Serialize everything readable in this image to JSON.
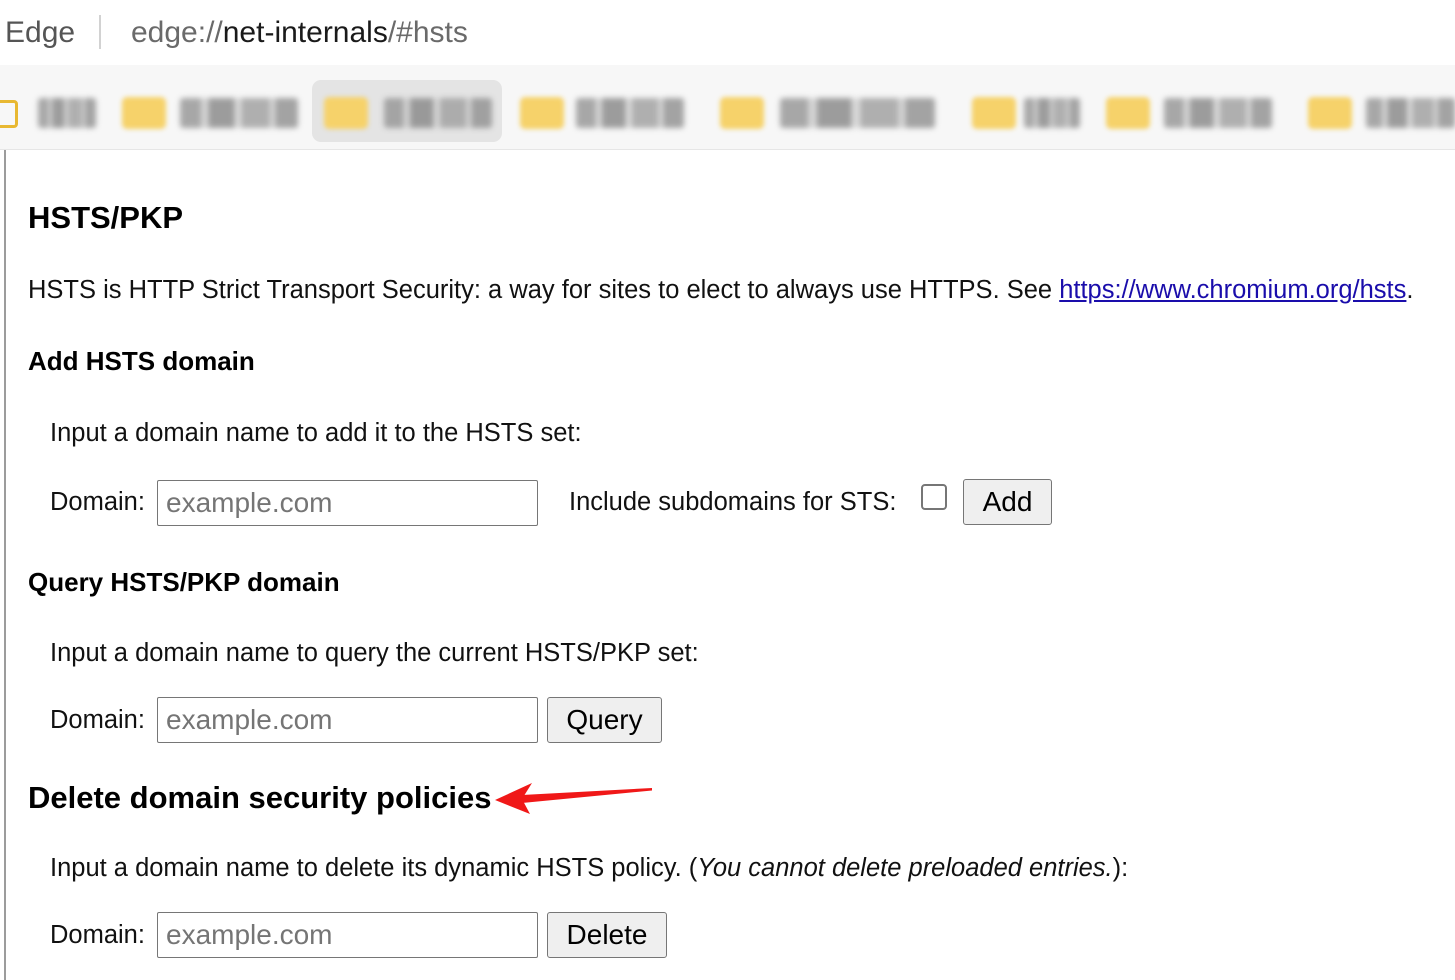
{
  "browser": {
    "app_name": "Edge",
    "url_scheme": "edge://",
    "url_host": "net-internals",
    "url_path": "/#hsts"
  },
  "bookmarks": [
    {
      "icon": "folder-icon",
      "highlighted": false
    },
    {
      "icon": "folder-icon",
      "highlighted": false
    },
    {
      "icon": "folder-icon",
      "highlighted": true
    },
    {
      "icon": "folder-icon",
      "highlighted": false
    },
    {
      "icon": "folder-icon",
      "highlighted": false
    },
    {
      "icon": "folder-icon",
      "highlighted": false
    },
    {
      "icon": "folder-icon",
      "highlighted": false
    },
    {
      "icon": "folder-icon",
      "highlighted": false
    }
  ],
  "page": {
    "title": "HSTS/PKP",
    "intro": {
      "text": "HSTS is HTTP Strict Transport Security: a way for sites to elect to always use HTTPS. See ",
      "link": "https://www.chromium.org/hsts",
      "suffix": "."
    },
    "add": {
      "heading": "Add HSTS domain",
      "instructions": "Input a domain name to add it to the HSTS set:",
      "domain_label": "Domain:",
      "domain_value": "",
      "domain_placeholder": "example.com",
      "subdomains_label": "Include subdomains for STS:",
      "subdomains_checked": false,
      "button_label": "Add"
    },
    "query": {
      "heading": "Query HSTS/PKP domain",
      "instructions": "Input a domain name to query the current HSTS/PKP set:",
      "domain_label": "Domain:",
      "domain_value": "",
      "domain_placeholder": "example.com",
      "button_label": "Query"
    },
    "delete": {
      "heading": "Delete domain security policies",
      "instructions_before": "Input a domain name to delete its dynamic HSTS policy. (",
      "instructions_italic": "You cannot delete preloaded entries.",
      "instructions_after": "):",
      "domain_label": "Domain:",
      "domain_value": "",
      "domain_placeholder": "example.com",
      "button_label": "Delete"
    }
  },
  "annotation": {
    "icon": "red-arrow-icon",
    "arrow_color": "#f01818"
  },
  "colors": {
    "link": "#1a0dab",
    "bookmark_folder": "#f6d26a"
  }
}
